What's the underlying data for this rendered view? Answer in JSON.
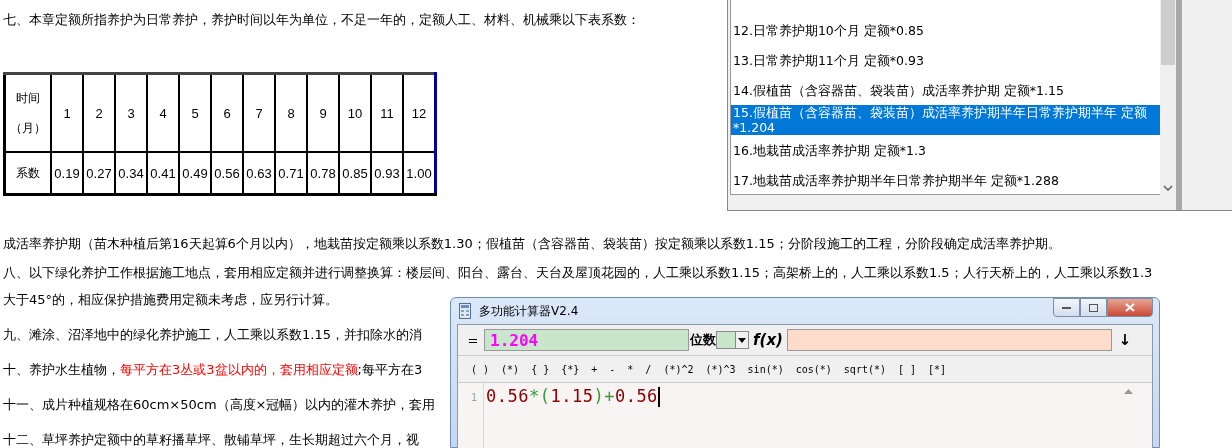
{
  "document": {
    "intro": "七、本章定额所指养护为日常养护，养护时间以年为单位，不足一年的，定额人工、材料、机械乘以下表系数：",
    "table": {
      "header_label": [
        "时间",
        "（月）"
      ],
      "months": [
        "1",
        "2",
        "3",
        "4",
        "5",
        "6",
        "7",
        "8",
        "9",
        "10",
        "11",
        "12"
      ],
      "row_label": "系数",
      "coefficients": [
        "0.19",
        "0.27",
        "0.34",
        "0.41",
        "0.49",
        "0.56",
        "0.63",
        "0.71",
        "0.78",
        "0.85",
        "0.93",
        "1.00"
      ]
    },
    "paragraphs": [
      {
        "parts": [
          {
            "text": "成活率养护期（苗木种植后第16天起算6个月以内），地栽苗按定额乘以系数1.30；假植苗（含容器苗、袋装苗）按定额乘以系数1.15；分阶段施工的工程，分阶段确定成活率养护期。",
            "emphasis": false
          }
        ]
      },
      {
        "parts": [
          {
            "text": "八、以下绿化养护工作根据施工地点，套用相应定额并进行调整换算：楼层间、阳台、露台、天台及屋顶花园的，人工乘以系数1.15；高架桥上的，人工乘以系数1.5；人行天桥上的，人工乘以系数1.3",
            "emphasis": false
          }
        ]
      },
      {
        "parts": [
          {
            "text": "大于45°的，相应保护措施费用定额未考虑，应另行计算。",
            "emphasis": false
          }
        ]
      },
      {
        "parts": [
          {
            "text": "九、滩涂、沼泽地中的绿化养护施工，人工乘以系数1.15，并扣除水的消",
            "emphasis": false
          }
        ]
      },
      {
        "parts": [
          {
            "text": "十、养护水生植物，",
            "emphasis": false
          },
          {
            "text": "每平方在3丛或3盆以内的，套用相应定额",
            "emphasis": true
          },
          {
            "text": ";每平方在3",
            "emphasis": false
          }
        ]
      },
      {
        "parts": [
          {
            "text": "十一、成片种植规格在60cm×50cm（高度×冠幅）以内的灌木养护，套用",
            "emphasis": false
          }
        ]
      },
      {
        "parts": [
          {
            "text": "十二、草坪养护定额中的草籽播草坪、散铺草坪，生长期超过六个月，视",
            "emphasis": false
          }
        ]
      }
    ]
  },
  "list_window": {
    "items": [
      {
        "label": "12.日常养护期10个月 定额*0.85",
        "selected": false
      },
      {
        "label": "13.日常养护期11个月 定额*0.93",
        "selected": false
      },
      {
        "label": "14.假植苗（含容器苗、袋装苗）成活率养护期 定额*1.15",
        "selected": false
      },
      {
        "label": "15.假植苗（含容器苗、袋装苗）成活率养护期半年日常养护期半年 定额*1.204",
        "selected": true
      },
      {
        "label": "16.地栽苗成活率养护期 定额*1.3",
        "selected": false
      },
      {
        "label": "17.地栽苗成活率养护期半年日常养护期半年 定额*1.288",
        "selected": false
      }
    ]
  },
  "calculator": {
    "title": "多功能计算器V2.4",
    "equals": "=",
    "result": "1.204",
    "digits_label": "位数",
    "fx_label": "f(x)",
    "enter_symbol": "↓",
    "toolbar": [
      "( )",
      "(*)",
      "{ }",
      "{*}",
      "+",
      "-",
      "*",
      "/",
      "(*)^2",
      "(*)^3",
      "sin(*)",
      "cos(*)",
      "sqrt(*)",
      "[ ]",
      "[*]"
    ],
    "editor": {
      "line_number": "1",
      "tokens": [
        {
          "text": "0.56",
          "kind": "number"
        },
        {
          "text": "*",
          "kind": "operator"
        },
        {
          "text": "(",
          "kind": "operator"
        },
        {
          "text": "1.15",
          "kind": "number"
        },
        {
          "text": ")",
          "kind": "operator"
        },
        {
          "text": "+",
          "kind": "operator"
        },
        {
          "text": "0.56",
          "kind": "number"
        }
      ]
    }
  }
}
